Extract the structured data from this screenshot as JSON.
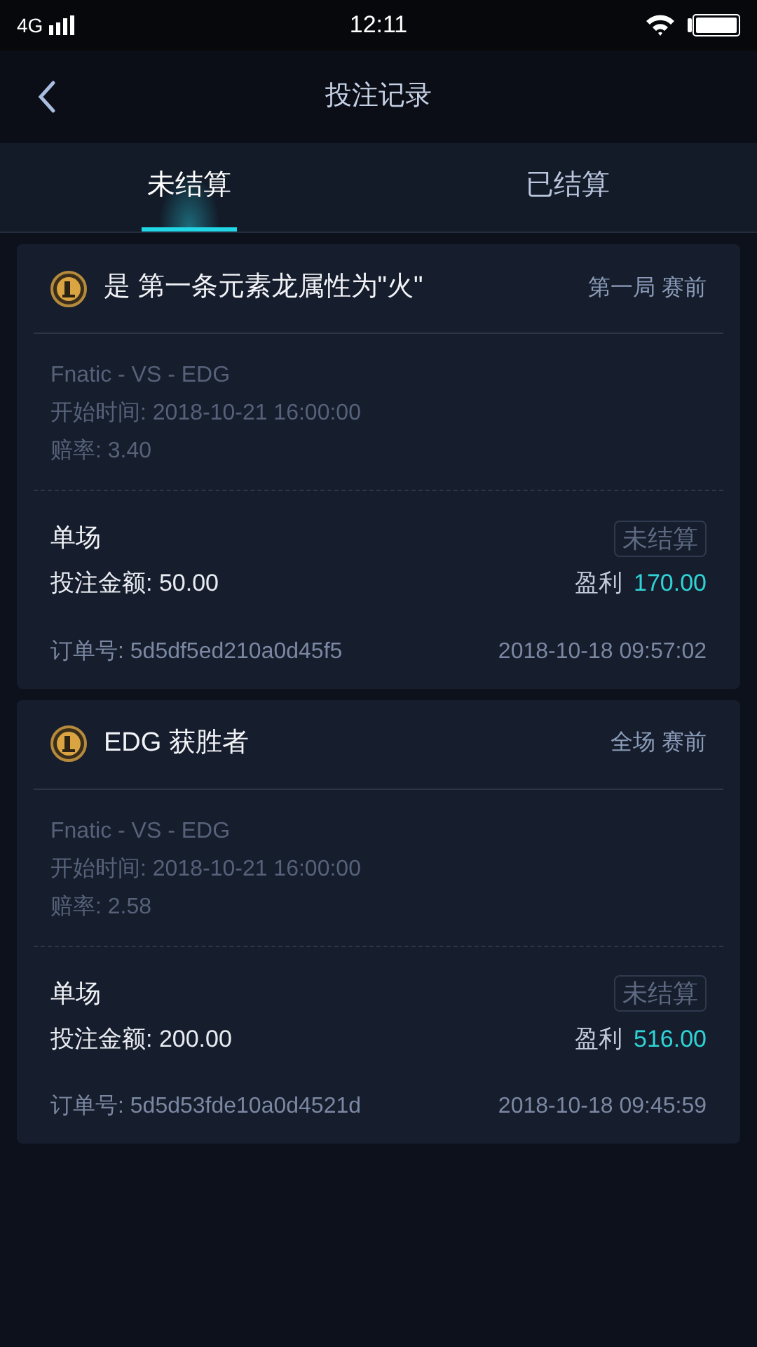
{
  "status_bar": {
    "network": "4G",
    "time": "12:11"
  },
  "header": {
    "title": "投注记录"
  },
  "tabs": [
    {
      "label": "未结算",
      "selected": true
    },
    {
      "label": "已结算",
      "selected": false
    }
  ],
  "bets": [
    {
      "title": "是 第一条元素龙属性为\"火\"",
      "stage": "第一局 赛前",
      "match": "Fnatic - VS - EDG",
      "start_time": "开始时间: 2018-10-21 16:00:00",
      "odds": "赔率: 3.40",
      "type": "单场",
      "status": "未结算",
      "stake": "投注金额: 50.00",
      "profit_label": "盈利",
      "profit": "170.00",
      "order": "订单号: 5d5df5ed210a0d45f5",
      "placed": "2018-10-18 09:57:02"
    },
    {
      "title": "EDG 获胜者",
      "stage": "全场 赛前",
      "match": "Fnatic - VS - EDG",
      "start_time": "开始时间: 2018-10-21 16:00:00",
      "odds": "赔率: 2.58",
      "type": "单场",
      "status": "未结算",
      "stake": "投注金额: 200.00",
      "profit_label": "盈利",
      "profit": "516.00",
      "order": "订单号: 5d5d53fde10a0d4521d",
      "placed": "2018-10-18 09:45:59"
    }
  ]
}
